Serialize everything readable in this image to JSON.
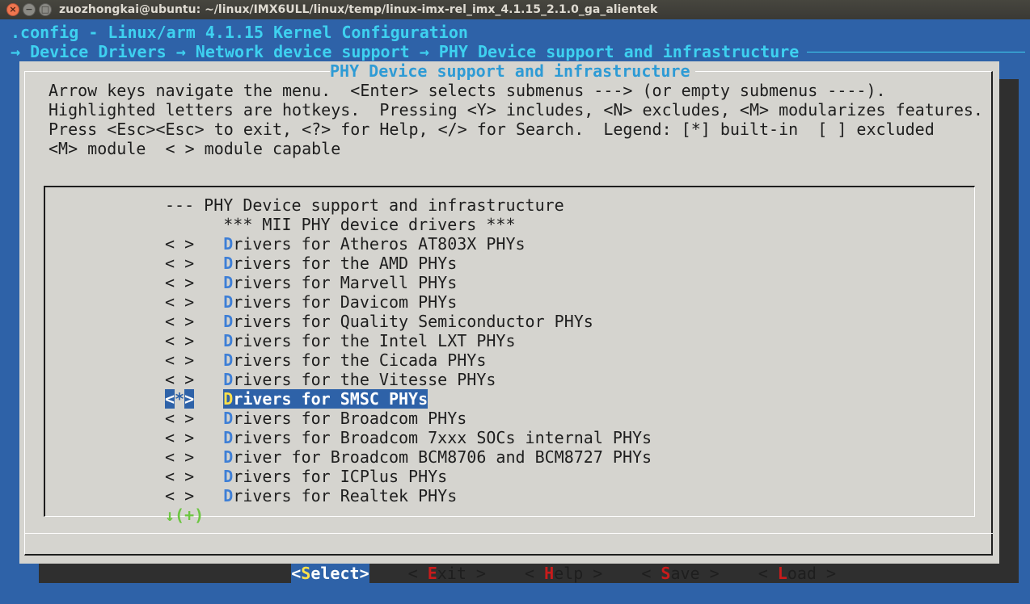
{
  "window": {
    "title": "zuozhongkai@ubuntu: ~/linux/IMX6ULL/linux/temp/linux-imx-rel_imx_4.1.15_2.1.0_ga_alientek"
  },
  "header": {
    "config_line": ".config - Linux/arm 4.1.15 Kernel Configuration",
    "breadcrumb": "→ Device Drivers → Network device support → PHY Device support and infrastructure"
  },
  "dialog": {
    "title": "PHY Device support and infrastructure",
    "help_lines": [
      "Arrow keys navigate the menu.  <Enter> selects submenus ---> (or empty submenus ----).",
      "Highlighted letters are hotkeys.  Pressing <Y> includes, <N> excludes, <M> modularizes features.",
      "Press <Esc><Esc> to exit, <?> for Help, </> for Search.  Legend: [*] built-in  [ ] excluded",
      "<M> module  < > module capable"
    ]
  },
  "menu": {
    "items": [
      {
        "prefix": "--- ",
        "hot": "",
        "rest": "PHY Device support and infrastructure"
      },
      {
        "prefix": "      ",
        "hot": "",
        "rest": "*** MII PHY device drivers ***"
      },
      {
        "prefix": "< >   ",
        "hot": "D",
        "rest": "rivers for Atheros AT803X PHYs"
      },
      {
        "prefix": "< >   ",
        "hot": "D",
        "rest": "rivers for the AMD PHYs"
      },
      {
        "prefix": "< >   ",
        "hot": "D",
        "rest": "rivers for Marvell PHYs"
      },
      {
        "prefix": "< >   ",
        "hot": "D",
        "rest": "rivers for Davicom PHYs"
      },
      {
        "prefix": "< >   ",
        "hot": "D",
        "rest": "rivers for Quality Semiconductor PHYs"
      },
      {
        "prefix": "< >   ",
        "hot": "D",
        "rest": "rivers for the Intel LXT PHYs"
      },
      {
        "prefix": "< >   ",
        "hot": "D",
        "rest": "rivers for the Cicada PHYs"
      },
      {
        "prefix": "< >   ",
        "hot": "D",
        "rest": "rivers for the Vitesse PHYs"
      },
      {
        "prefix": "<*>   ",
        "hot": "D",
        "rest": "rivers for SMSC PHYs",
        "selected": true
      },
      {
        "prefix": "< >   ",
        "hot": "D",
        "rest": "rivers for Broadcom PHYs"
      },
      {
        "prefix": "< >   ",
        "hot": "D",
        "rest": "rivers for Broadcom 7xxx SOCs internal PHYs"
      },
      {
        "prefix": "< >   ",
        "hot": "D",
        "rest": "river for Broadcom BCM8706 and BCM8727 PHYs"
      },
      {
        "prefix": "< >   ",
        "hot": "D",
        "rest": "rivers for ICPlus PHYs"
      },
      {
        "prefix": "< >   ",
        "hot": "D",
        "rest": "rivers for Realtek PHYs"
      }
    ],
    "more_indicator": "↓(+)"
  },
  "buttons": {
    "select": {
      "open": "<",
      "hot": "S",
      "rest": "elect",
      "close": ">"
    },
    "exit": {
      "open": "< ",
      "hot": "E",
      "rest": "xit",
      "close": " >"
    },
    "help": {
      "open": "< ",
      "hot": "H",
      "rest": "elp",
      "close": " >"
    },
    "save": {
      "open": "< ",
      "hot": "S",
      "rest": "ave",
      "close": " >"
    },
    "load": {
      "open": "< ",
      "hot": "L",
      "rest": "oad",
      "close": " >"
    }
  },
  "colors": {
    "background": "#2e62a8",
    "dialog": "#d5d4cf",
    "header_text": "#3ed1f0",
    "hotkey": "#3e7fd6",
    "button_hotkey": "#c91b1b",
    "selected_hotkey": "#ffe14a",
    "more_indicator": "#6cc641"
  }
}
